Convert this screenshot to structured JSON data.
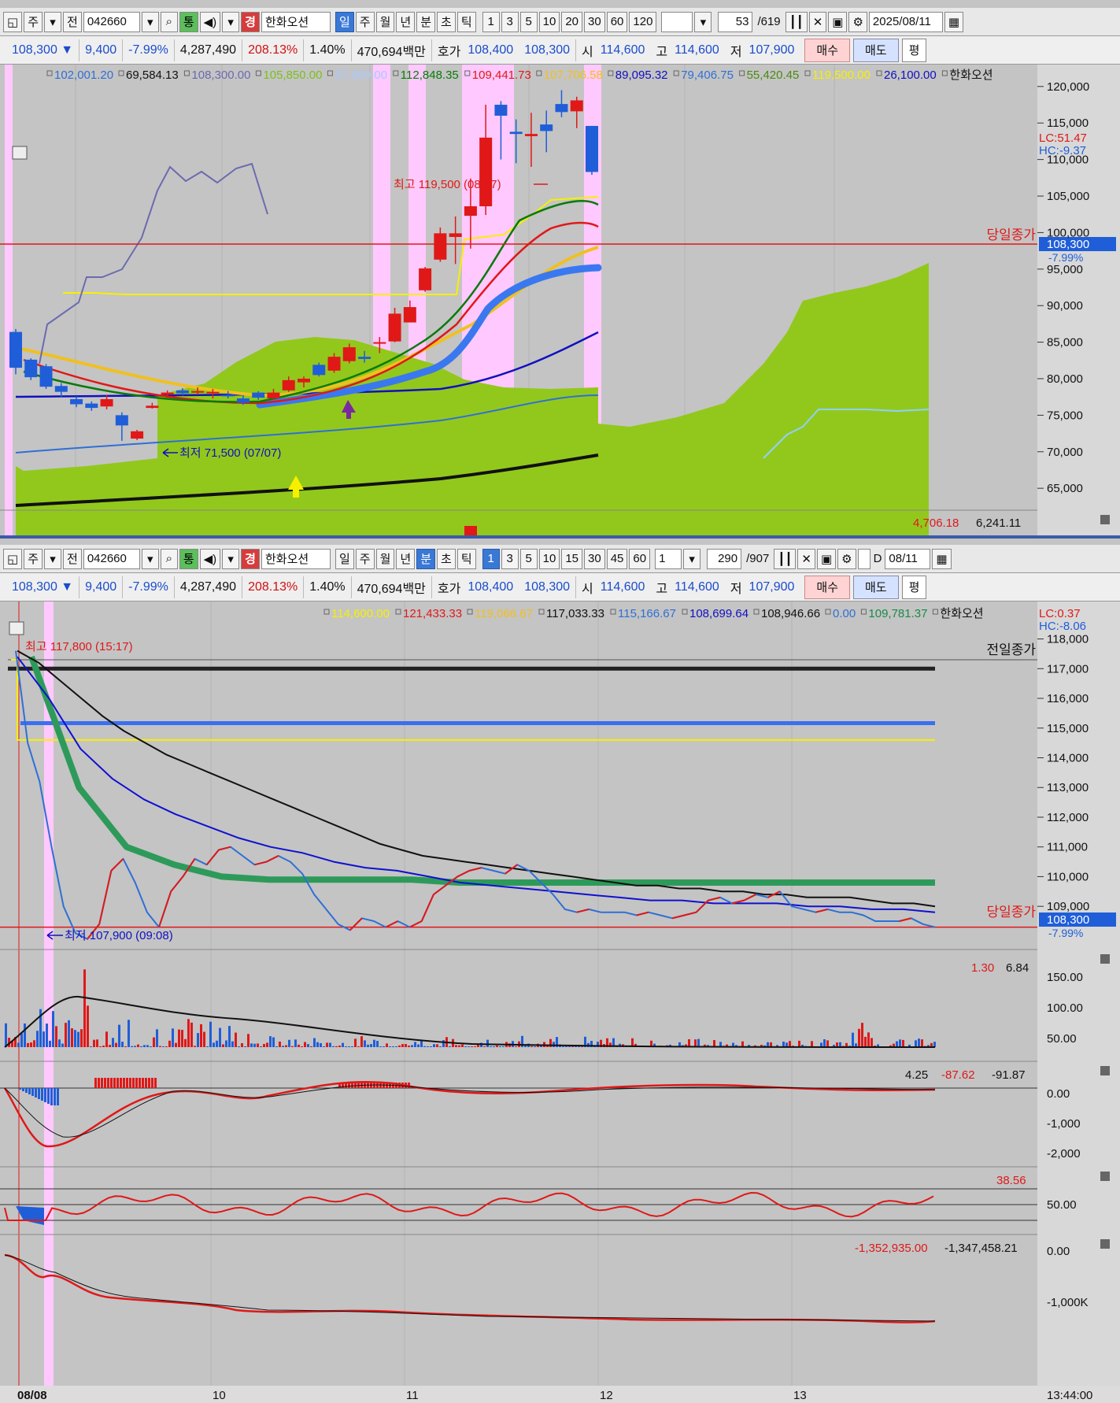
{
  "colors": {
    "up": "#e01818",
    "down": "#1f5ed8",
    "cloud": "#92c81c",
    "pink": "#ffc9ff",
    "panel": "#c4c4c4"
  },
  "top": {
    "toolbar": {
      "mode": "주",
      "prev": "전",
      "code": "042660",
      "stock_badge": "경",
      "stock_name": "한화오션",
      "periods": [
        "일",
        "주",
        "월",
        "년",
        "분",
        "초",
        "틱"
      ],
      "active_period": "일",
      "intervals": [
        "1",
        "3",
        "5",
        "10",
        "20",
        "30",
        "60",
        "120"
      ],
      "count": "53",
      "total": "/619",
      "date": "2025/08/11"
    },
    "quote": {
      "price": "108,300 ▼",
      "change": "9,400",
      "pct": "-7.99%",
      "volume": "4,287,490",
      "vol_ratio": "208.13%",
      "turnover": "1.40%",
      "amount": "470,694백만",
      "ask_label": "호가",
      "ask": "108,400",
      "bid": "108,300",
      "open_label": "시",
      "open": "114,600",
      "high_label": "고",
      "high": "114,600",
      "low_label": "저",
      "low": "107,900",
      "buy": "매수",
      "sell": "매도",
      "avg": "평"
    },
    "legend": [
      {
        "v": "102,001.20",
        "c": "#2f6fd6"
      },
      {
        "v": "69,584.13",
        "c": "#111"
      },
      {
        "v": "108,300.00",
        "c": "#6a6ab0"
      },
      {
        "v": "105,850.00",
        "c": "#7cbf1c"
      },
      {
        "v": "97,800.00",
        "c": "#a9c8ff"
      },
      {
        "v": "112,848.35",
        "c": "#0a7a0a"
      },
      {
        "v": "109,441.73",
        "c": "#e01818"
      },
      {
        "v": "107,706.58",
        "c": "#f0c020"
      },
      {
        "v": "89,095.32",
        "c": "#1010c0"
      },
      {
        "v": "79,406.75",
        "c": "#2f6fd6"
      },
      {
        "v": "55,420.45",
        "c": "#4a8a10"
      },
      {
        "v": "119,500.00",
        "c": "#f6f000"
      },
      {
        "v": "26,100.00",
        "c": "#1010c0"
      },
      {
        "v": "한화오션",
        "c": "#111"
      }
    ],
    "lc": "LC:51.47",
    "hc": "HC:-9.37",
    "annot_high": "최고 119,500 (08/07)",
    "annot_low": "최저 71,500 (07/07)",
    "close_label": "당일종가",
    "price_tag": "108,300",
    "pct_tag": "-7.99%",
    "bottom_vals": [
      "4,706.18",
      "6,241.11"
    ],
    "yticks": [
      "120,000",
      "115,000",
      "110,000",
      "105,000",
      "100,000",
      "95,000",
      "90,000",
      "85,000",
      "80,000",
      "75,000",
      "70,000",
      "65,000"
    ],
    "chart_data": {
      "type": "candlestick",
      "ylim": [
        62000,
        123000
      ],
      "yticks": [
        120000,
        115000,
        110000,
        105000,
        100000,
        95000,
        90000,
        85000,
        80000,
        75000,
        70000,
        65000
      ],
      "candles": [
        [
          86400,
          86800,
          80600,
          81500
        ],
        [
          82600,
          82800,
          79800,
          80200
        ],
        [
          81700,
          82000,
          78600,
          78900
        ],
        [
          79000,
          79400,
          77500,
          78200
        ],
        [
          77200,
          77600,
          76100,
          76500
        ],
        [
          76600,
          76900,
          75600,
          76000
        ],
        [
          76200,
          77800,
          75800,
          77200
        ],
        [
          75000,
          75400,
          71500,
          73600
        ],
        [
          71800,
          73000,
          71600,
          72800
        ],
        [
          76000,
          76700,
          75900,
          76300
        ],
        [
          77800,
          78400,
          77400,
          78100
        ],
        [
          78400,
          78700,
          77700,
          78000
        ],
        [
          78200,
          78800,
          77800,
          78300
        ],
        [
          78000,
          78600,
          77300,
          78200
        ],
        [
          77800,
          78300,
          77300,
          77600
        ],
        [
          77300,
          77700,
          76400,
          76700
        ],
        [
          78100,
          78300,
          77100,
          77400
        ],
        [
          77300,
          78600,
          77200,
          78100
        ],
        [
          78400,
          80300,
          78200,
          79800
        ],
        [
          79500,
          80300,
          78800,
          80000
        ],
        [
          81900,
          82200,
          80300,
          80500
        ],
        [
          81100,
          83500,
          80800,
          83000
        ],
        [
          82400,
          84800,
          82100,
          84300
        ],
        [
          83000,
          83800,
          82200,
          82700
        ],
        [
          84900,
          85700,
          83500,
          85000
        ],
        [
          85100,
          89700,
          85000,
          88900
        ],
        [
          87700,
          90700,
          87700,
          89800
        ],
        [
          92100,
          95300,
          91900,
          95100
        ],
        [
          96300,
          100700,
          96000,
          99900
        ],
        [
          99400,
          102200,
          95700,
          99900
        ],
        [
          102300,
          107400,
          97800,
          103600
        ],
        [
          103600,
          117500,
          102400,
          113000
        ],
        [
          117500,
          118000,
          110000,
          116000
        ],
        [
          113800,
          115500,
          109500,
          113500
        ],
        [
          113200,
          116400,
          109000,
          113500
        ],
        [
          114800,
          116700,
          111000,
          113900
        ],
        [
          117600,
          119500,
          115800,
          116500
        ],
        [
          116600,
          118600,
          114300,
          118100
        ],
        [
          114600,
          114600,
          107900,
          108300
        ]
      ],
      "close": 108300
    }
  },
  "bottom": {
    "toolbar": {
      "mode": "주",
      "prev": "전",
      "code": "042660",
      "stock_badge": "경",
      "stock_name": "한화오션",
      "periods": [
        "일",
        "주",
        "월",
        "년",
        "분",
        "초",
        "틱"
      ],
      "active_period": "분",
      "intervals": [
        "1",
        "3",
        "5",
        "10",
        "15",
        "30",
        "45",
        "60"
      ],
      "active_interval": "1",
      "unit": "1",
      "count": "290",
      "total": "/907",
      "checkbox_label": "D",
      "date": "08/11"
    },
    "quote": {
      "price": "108,300 ▼",
      "change": "9,400",
      "pct": "-7.99%",
      "volume": "4,287,490",
      "vol_ratio": "208.13%",
      "turnover": "1.40%",
      "amount": "470,694백만",
      "ask_label": "호가",
      "ask": "108,400",
      "bid": "108,300",
      "open_label": "시",
      "open": "114,600",
      "high_label": "고",
      "high": "114,600",
      "low_label": "저",
      "low": "107,900",
      "buy": "매수",
      "sell": "매도",
      "avg": "평"
    },
    "legend": [
      {
        "v": "114,600.00",
        "c": "#f6f000"
      },
      {
        "v": "121,433.33",
        "c": "#e01818"
      },
      {
        "v": "119,066.67",
        "c": "#f0c020"
      },
      {
        "v": "117,033.33",
        "c": "#111"
      },
      {
        "v": "115,166.67",
        "c": "#2f6fd6"
      },
      {
        "v": "108,699.64",
        "c": "#1010c0"
      },
      {
        "v": "108,946.66",
        "c": "#111"
      },
      {
        "v": "0.00",
        "c": "#2f6fd6"
      },
      {
        "v": "109,781.37",
        "c": "#1a8a4a"
      },
      {
        "v": "한화오션",
        "c": "#111"
      }
    ],
    "lc": "LC:0.37",
    "hc": "HC:-8.06",
    "annot_high": "최고 117,800 (15:17)",
    "annot_low": "최저 107,900 (09:08)",
    "prev_close_label": "전일종가",
    "close_label": "당일종가",
    "price_tag": "108,300",
    "pct_tag": "-7.99%",
    "yticks": [
      "118,000",
      "117,000",
      "116,000",
      "115,000",
      "114,000",
      "113,000",
      "112,000",
      "111,000",
      "110,000",
      "109,000"
    ],
    "chart_data": {
      "type": "line",
      "ylim": [
        107600,
        118200
      ],
      "prev_close": 117000,
      "ma_blue_level": 115166,
      "ma_yellow_level": 114600,
      "close": 108300,
      "price": [
        117600,
        114500,
        113200,
        111000,
        109000,
        108100,
        107900,
        108400,
        110200,
        110600,
        109800,
        108800,
        108300,
        109500,
        110000,
        110600,
        110400,
        110900,
        111000,
        110700,
        110400,
        110500,
        110700,
        110500,
        110100,
        109400,
        108900,
        108400,
        108200,
        108600,
        108500,
        108300,
        108500,
        108300,
        108500,
        109400,
        109700,
        110000,
        110200,
        110300,
        110200,
        110100,
        110400,
        110200,
        109800,
        109400,
        108900,
        108800,
        108900,
        108800,
        108800,
        108800,
        108700,
        108800,
        108700,
        108600,
        108700,
        108800,
        109200,
        109300,
        109100,
        109200,
        109400,
        109300,
        109500,
        109000,
        108900,
        108800,
        108900,
        108800,
        108800,
        108700,
        108500,
        108500,
        108500,
        108600,
        108400,
        108300
      ],
      "ma_black": [
        117600,
        117200,
        116600,
        116000,
        115400,
        114900,
        114500,
        114100,
        113800,
        113500,
        113200,
        112900,
        112600,
        112300,
        112000,
        111700,
        111400,
        111100,
        110900,
        110700,
        110600,
        110500,
        110400,
        110300,
        110200,
        110100,
        110000,
        109900,
        109800,
        109700,
        109700,
        109600,
        109600,
        109500,
        109500,
        109400,
        109400,
        109300,
        109300,
        109300,
        109200,
        109100,
        109100,
        109000
      ],
      "ma_blue": [
        117400,
        116000,
        114300,
        113300,
        112600,
        112100,
        111700,
        111300,
        111000,
        110800,
        110500,
        110300,
        110200,
        110000,
        109800,
        109700,
        109600,
        109500,
        109400,
        109300,
        109200,
        109200,
        109100,
        109100,
        109100,
        109000,
        109000,
        108900,
        108900,
        108800
      ],
      "ma_green": [
        117400,
        113000,
        111000,
        110400,
        110000,
        109900,
        109900,
        109900,
        109900,
        109800,
        109800,
        109800,
        109800,
        109800,
        109800,
        109800,
        109800,
        109800,
        109800,
        109800
      ]
    },
    "vol_vals": [
      "1.30",
      "6.84"
    ],
    "vol_ticks": [
      "150.00",
      "100.00",
      "50.00"
    ],
    "macd_vals": [
      "4.25",
      "-87.62",
      "-91.87"
    ],
    "macd_ticks": [
      "0.00",
      "-1,000",
      "-2,000"
    ],
    "rsi_vals": [
      "38.56"
    ],
    "rsi_ticks": [
      "50.00"
    ],
    "obv_vals": [
      "-1,352,935.00",
      "-1,347,458.21"
    ],
    "obv_ticks": [
      "0.00",
      "-1,000K"
    ],
    "xticks": [
      "08/08",
      "10",
      "11",
      "12",
      "13"
    ],
    "time": "13:44:00"
  }
}
